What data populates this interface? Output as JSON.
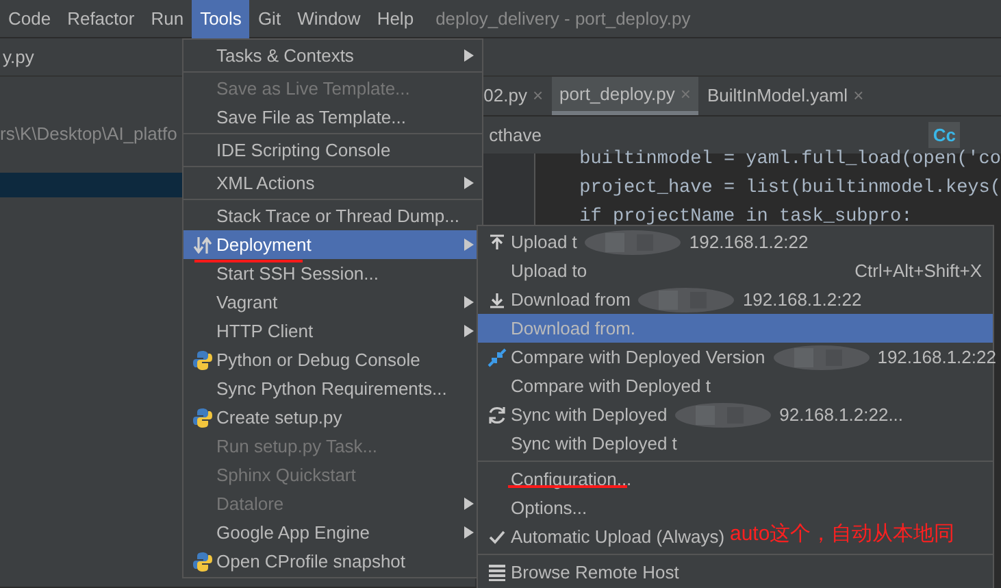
{
  "menu_bar": [
    {
      "label": "Code",
      "selected": false
    },
    {
      "label": "Refactor",
      "selected": false
    },
    {
      "label": "Run",
      "selected": false
    },
    {
      "label": "Tools",
      "selected": true
    },
    {
      "label": "Git",
      "selected": false
    },
    {
      "label": "Window",
      "selected": false
    },
    {
      "label": "Help",
      "selected": false
    }
  ],
  "window": {
    "title": "deploy_delivery - port_deploy.py"
  },
  "nav_bar": {
    "file": "y.py"
  },
  "project_panel": {
    "path": "rs\\K\\Desktop\\AI_platfo"
  },
  "tabs": [
    {
      "label": "02.py",
      "close": "×",
      "selected": false
    },
    {
      "label": "port_deploy.py",
      "close": "×",
      "selected": true
    },
    {
      "label": "BuiltInModel.yaml",
      "close": "×",
      "selected": false
    }
  ],
  "find_bar": {
    "value": "cthave",
    "match_case_label": "Cc",
    "match_case": true
  },
  "code_lines": [
    "builtinmodel = yaml.full_load(open('co",
    "project_have = list(builtinmodel.keys(",
    "if projectName in task_subpro:"
  ],
  "tools_menu": [
    {
      "kind": "item",
      "label": "Tasks & Contexts",
      "disabled": false,
      "selected": false,
      "submenu": true
    },
    {
      "kind": "separator"
    },
    {
      "kind": "item",
      "label": "Save as Live Template...",
      "disabled": true,
      "selected": false,
      "submenu": false
    },
    {
      "kind": "item",
      "label": "Save File as Template...",
      "disabled": false,
      "selected": false,
      "submenu": false
    },
    {
      "kind": "separator"
    },
    {
      "kind": "item",
      "label": "IDE Scripting Console",
      "disabled": false,
      "selected": false,
      "submenu": false
    },
    {
      "kind": "separator"
    },
    {
      "kind": "item",
      "label": "XML Actions",
      "disabled": false,
      "selected": false,
      "submenu": true
    },
    {
      "kind": "separator"
    },
    {
      "kind": "item",
      "label": "Stack Trace or Thread Dump...",
      "disabled": false,
      "selected": false,
      "submenu": false
    },
    {
      "kind": "item",
      "label": "Deployment",
      "disabled": false,
      "selected": true,
      "submenu": true
    },
    {
      "kind": "item",
      "label": "Start SSH Session...",
      "disabled": false,
      "selected": false,
      "submenu": false
    },
    {
      "kind": "item",
      "label": "Vagrant",
      "disabled": false,
      "selected": false,
      "submenu": true
    },
    {
      "kind": "item",
      "label": "HTTP Client",
      "disabled": false,
      "selected": false,
      "submenu": true
    },
    {
      "kind": "item",
      "label": "Python or Debug Console",
      "disabled": false,
      "selected": false,
      "submenu": false
    },
    {
      "kind": "item",
      "label": "Sync Python Requirements...",
      "disabled": false,
      "selected": false,
      "submenu": false
    },
    {
      "kind": "item",
      "label": "Create setup.py",
      "disabled": false,
      "selected": false,
      "submenu": false
    },
    {
      "kind": "item",
      "label": "Run setup.py Task...",
      "disabled": true,
      "selected": false,
      "submenu": false
    },
    {
      "kind": "item",
      "label": "Sphinx Quickstart",
      "disabled": true,
      "selected": false,
      "submenu": false
    },
    {
      "kind": "item",
      "label": "Datalore",
      "disabled": true,
      "selected": false,
      "submenu": true
    },
    {
      "kind": "item",
      "label": "Google App Engine",
      "disabled": false,
      "selected": false,
      "submenu": true
    },
    {
      "kind": "item",
      "label": "Open CProfile snapshot",
      "disabled": false,
      "selected": false,
      "submenu": false
    }
  ],
  "deployment_menu": [
    {
      "kind": "item",
      "label": "Upload t",
      "host": "192.168.1.2:22",
      "selected": false,
      "checked": false
    },
    {
      "kind": "item",
      "label": "Upload to",
      "shortcut": "Ctrl+Alt+Shift+X",
      "selected": false,
      "checked": false
    },
    {
      "kind": "item",
      "label": "Download from",
      "host": "192.168.1.2:22",
      "selected": false,
      "checked": false
    },
    {
      "kind": "item",
      "label": "Download from.",
      "selected": true,
      "checked": false
    },
    {
      "kind": "item",
      "label": "Compare with Deployed Version",
      "host": "192.168.1.2:22",
      "selected": false,
      "checked": false
    },
    {
      "kind": "item",
      "label": "Compare with Deployed t",
      "selected": false,
      "checked": false
    },
    {
      "kind": "item",
      "label": "Sync with Deployed",
      "host": "92.168.1.2:22...",
      "selected": false,
      "checked": false
    },
    {
      "kind": "item",
      "label": "Sync with Deployed t",
      "selected": false,
      "checked": false
    },
    {
      "kind": "separator"
    },
    {
      "kind": "item",
      "label": "Configuration...",
      "selected": false,
      "checked": false
    },
    {
      "kind": "item",
      "label": "Options...",
      "selected": false,
      "checked": false
    },
    {
      "kind": "item",
      "label": "Automatic Upload (Always)",
      "selected": false,
      "checked": true
    },
    {
      "kind": "separator"
    },
    {
      "kind": "item",
      "label": "Browse Remote Host",
      "selected": false,
      "checked": false
    }
  ],
  "annotation": {
    "text": "auto这个，自动从本地同"
  }
}
